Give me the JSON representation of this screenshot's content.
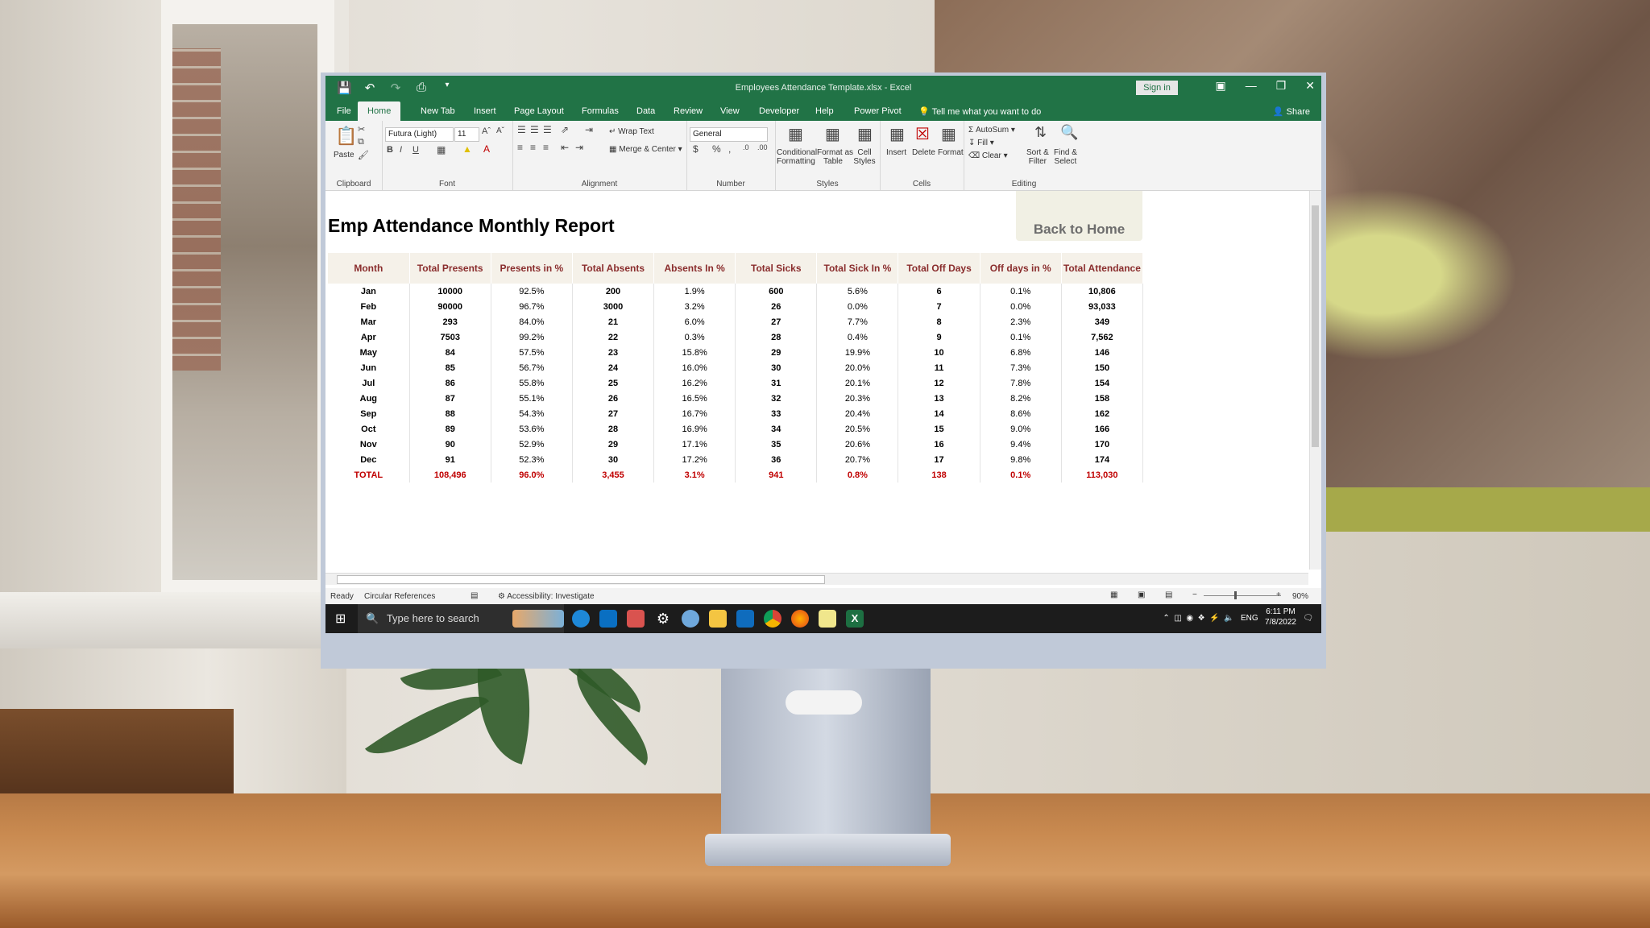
{
  "window": {
    "title": "Employees Attendance Template.xlsx  -  Excel",
    "signin": "Sign in",
    "share": "Share",
    "tell_me": "Tell me what you want to do"
  },
  "tabs": [
    "File",
    "Home",
    "New Tab",
    "Insert",
    "Page Layout",
    "Formulas",
    "Data",
    "Review",
    "View",
    "Developer",
    "Help",
    "Power Pivot"
  ],
  "active_tab": "Home",
  "ribbon": {
    "clipboard": {
      "label": "Clipboard",
      "paste": "Paste"
    },
    "font": {
      "label": "Font",
      "name": "Futura (Light)",
      "size": "11"
    },
    "alignment": {
      "label": "Alignment",
      "wrap": "Wrap Text",
      "merge": "Merge & Center"
    },
    "number": {
      "label": "Number",
      "format": "General"
    },
    "styles": {
      "label": "Styles",
      "conditional": "Conditional",
      "conditional2": "Formatting",
      "format_as": "Format as",
      "format_as2": "Table",
      "cell": "Cell",
      "cell2": "Styles"
    },
    "cells": {
      "label": "Cells",
      "insert": "Insert",
      "delete": "Delete",
      "format": "Format"
    },
    "editing": {
      "label": "Editing",
      "autosum": "AutoSum",
      "fill": "Fill",
      "clear": "Clear",
      "sort": "Sort &",
      "sort2": "Filter",
      "find": "Find &",
      "find2": "Select"
    }
  },
  "sheet": {
    "title": "Emp Attendance Monthly Report",
    "back_button": "Back to Home",
    "headers": [
      "Month",
      "Total Presents",
      "Presents in %",
      "Total Absents",
      "Absents In %",
      "Total Sicks",
      "Total Sick In %",
      "Total Off Days",
      "Off days in %",
      "Total Attendance"
    ],
    "rows": [
      [
        "Jan",
        "10000",
        "92.5%",
        "200",
        "1.9%",
        "600",
        "5.6%",
        "6",
        "0.1%",
        "10,806"
      ],
      [
        "Feb",
        "90000",
        "96.7%",
        "3000",
        "3.2%",
        "26",
        "0.0%",
        "7",
        "0.0%",
        "93,033"
      ],
      [
        "Mar",
        "293",
        "84.0%",
        "21",
        "6.0%",
        "27",
        "7.7%",
        "8",
        "2.3%",
        "349"
      ],
      [
        "Apr",
        "7503",
        "99.2%",
        "22",
        "0.3%",
        "28",
        "0.4%",
        "9",
        "0.1%",
        "7,562"
      ],
      [
        "May",
        "84",
        "57.5%",
        "23",
        "15.8%",
        "29",
        "19.9%",
        "10",
        "6.8%",
        "146"
      ],
      [
        "Jun",
        "85",
        "56.7%",
        "24",
        "16.0%",
        "30",
        "20.0%",
        "11",
        "7.3%",
        "150"
      ],
      [
        "Jul",
        "86",
        "55.8%",
        "25",
        "16.2%",
        "31",
        "20.1%",
        "12",
        "7.8%",
        "154"
      ],
      [
        "Aug",
        "87",
        "55.1%",
        "26",
        "16.5%",
        "32",
        "20.3%",
        "13",
        "8.2%",
        "158"
      ],
      [
        "Sep",
        "88",
        "54.3%",
        "27",
        "16.7%",
        "33",
        "20.4%",
        "14",
        "8.6%",
        "162"
      ],
      [
        "Oct",
        "89",
        "53.6%",
        "28",
        "16.9%",
        "34",
        "20.5%",
        "15",
        "9.0%",
        "166"
      ],
      [
        "Nov",
        "90",
        "52.9%",
        "29",
        "17.1%",
        "35",
        "20.6%",
        "16",
        "9.4%",
        "170"
      ],
      [
        "Dec",
        "91",
        "52.3%",
        "30",
        "17.2%",
        "36",
        "20.7%",
        "17",
        "9.8%",
        "174"
      ]
    ],
    "total": [
      "TOTAL",
      "108,496",
      "96.0%",
      "3,455",
      "3.1%",
      "941",
      "0.8%",
      "138",
      "0.1%",
      "113,030"
    ]
  },
  "status": {
    "ready": "Ready",
    "circular": "Circular References",
    "accessibility": "Accessibility: Investigate",
    "zoom": "90%"
  },
  "taskbar": {
    "search_placeholder": "Type here to search",
    "lang": "ENG",
    "time": "6:11 PM",
    "date": "7/8/2022"
  }
}
